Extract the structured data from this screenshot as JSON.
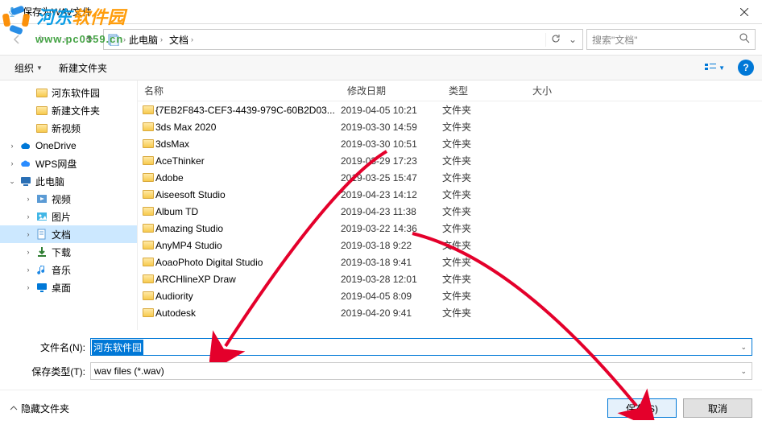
{
  "window": {
    "title": "保存为WAV文件"
  },
  "breadcrumb": {
    "items": [
      "此电脑",
      "文档"
    ]
  },
  "search": {
    "placeholder": "搜索\"文档\""
  },
  "toolbar": {
    "organize": "组织",
    "new_folder": "新建文件夹"
  },
  "tree": [
    {
      "label": "河东软件园",
      "icon": "folder",
      "indent": 1,
      "sel": false
    },
    {
      "label": "新建文件夹",
      "icon": "folder",
      "indent": 1,
      "sel": false
    },
    {
      "label": "新视频",
      "icon": "folder",
      "indent": 1,
      "sel": false
    },
    {
      "label": "OneDrive",
      "icon": "onedrive",
      "indent": 0,
      "sel": false,
      "exp": ">"
    },
    {
      "label": "WPS网盘",
      "icon": "wps",
      "indent": 0,
      "sel": false,
      "exp": ">"
    },
    {
      "label": "此电脑",
      "icon": "pc",
      "indent": 0,
      "sel": false,
      "exp": "v"
    },
    {
      "label": "视频",
      "icon": "video",
      "indent": 1,
      "sel": false,
      "exp": ">"
    },
    {
      "label": "图片",
      "icon": "picture",
      "indent": 1,
      "sel": false,
      "exp": ">"
    },
    {
      "label": "文档",
      "icon": "document",
      "indent": 1,
      "sel": true,
      "exp": ">"
    },
    {
      "label": "下载",
      "icon": "download",
      "indent": 1,
      "sel": false,
      "exp": ">"
    },
    {
      "label": "音乐",
      "icon": "music",
      "indent": 1,
      "sel": false,
      "exp": ">"
    },
    {
      "label": "桌面",
      "icon": "desktop",
      "indent": 1,
      "sel": false,
      "exp": ">"
    }
  ],
  "columns": {
    "name": "名称",
    "date": "修改日期",
    "type": "类型",
    "size": "大小"
  },
  "files": [
    {
      "name": "{7EB2F843-CEF3-4439-979C-60B2D03...",
      "date": "2019-04-05 10:21",
      "type": "文件夹"
    },
    {
      "name": "3ds Max 2020",
      "date": "2019-03-30 14:59",
      "type": "文件夹"
    },
    {
      "name": "3dsMax",
      "date": "2019-03-30 10:51",
      "type": "文件夹"
    },
    {
      "name": "AceThinker",
      "date": "2019-03-29 17:23",
      "type": "文件夹"
    },
    {
      "name": "Adobe",
      "date": "2019-03-25 15:47",
      "type": "文件夹"
    },
    {
      "name": "Aiseesoft Studio",
      "date": "2019-04-23 14:12",
      "type": "文件夹"
    },
    {
      "name": "Album TD",
      "date": "2019-04-23 11:38",
      "type": "文件夹"
    },
    {
      "name": "Amazing Studio",
      "date": "2019-03-22 14:36",
      "type": "文件夹"
    },
    {
      "name": "AnyMP4 Studio",
      "date": "2019-03-18 9:22",
      "type": "文件夹"
    },
    {
      "name": "AoaoPhoto Digital Studio",
      "date": "2019-03-18 9:41",
      "type": "文件夹"
    },
    {
      "name": "ARCHlineXP Draw",
      "date": "2019-03-28 12:01",
      "type": "文件夹"
    },
    {
      "name": "Audiority",
      "date": "2019-04-05 8:09",
      "type": "文件夹"
    },
    {
      "name": "Autodesk",
      "date": "2019-04-20 9:41",
      "type": "文件夹"
    }
  ],
  "filename": {
    "label": "文件名(N):",
    "value": "河东软件园"
  },
  "filetype": {
    "label": "保存类型(T):",
    "value": "wav files (*.wav)"
  },
  "footer": {
    "hide": "隐藏文件夹",
    "save": "保存(S)",
    "cancel": "取消"
  },
  "watermark": {
    "text1": "河东",
    "text2": "软件园",
    "url": "www.pc0359.cn"
  }
}
